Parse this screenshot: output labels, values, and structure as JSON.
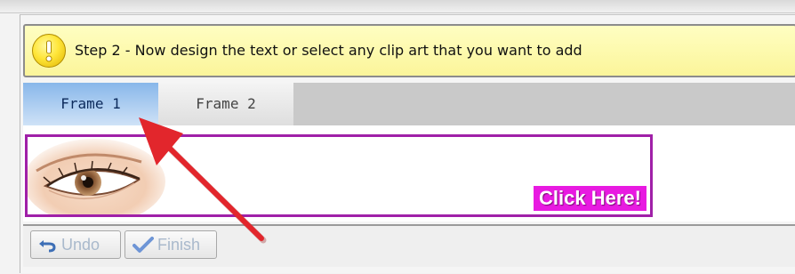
{
  "step": {
    "text": "Step 2 - Now design the text or select any clip art that you want to add",
    "icon": "warning-exclamation-icon"
  },
  "tabs": [
    {
      "label": "Frame 1",
      "active": true
    },
    {
      "label": "Frame 2",
      "active": false
    }
  ],
  "banner": {
    "image": "eye-clipart",
    "button_label": "Click Here!",
    "border_color": "#a020a8",
    "button_color": "#e81ae1"
  },
  "toolbar": {
    "undo_label": "Undo",
    "undo_icon": "undo-arrow-icon",
    "finish_label": "Finish",
    "finish_icon": "checkmark-icon"
  },
  "colors": {
    "step_bar": "#fbf59a",
    "active_tab": "#88b7ea",
    "annotation_arrow": "#e2262c"
  }
}
